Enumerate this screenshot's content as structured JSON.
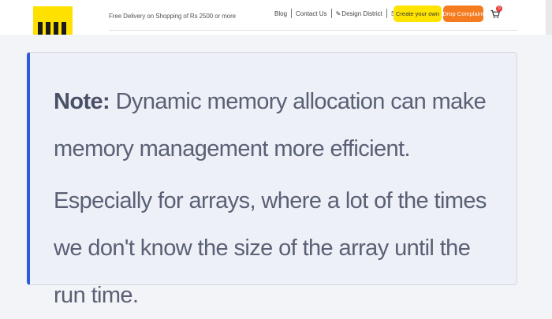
{
  "header": {
    "delivery_text": "Free Delivery on Shopping of Rs 2500 or more",
    "nav": {
      "blog": "Blog",
      "contact": "Contact Us",
      "design_district": "Design District",
      "signup": "Signup"
    },
    "buttons": {
      "create": "Create your own",
      "complaint": "Drop Complaint"
    },
    "cart_count": "0",
    "icons": {
      "logo": "brand-logo",
      "pencil": "pencil-icon",
      "cart": "cart-icon"
    },
    "colors": {
      "create_button": "#ffe400",
      "complaint_button": "#f47b20",
      "logo_bg": "#ffe100"
    }
  },
  "note": {
    "label": "Note:",
    "line1": "Dynamic memory allocation can make memory management more efficient.",
    "line2": "Especially for arrays, where a lot of the times we don't know the size of the array until the run time.",
    "accent_color": "#2b5ed8"
  }
}
